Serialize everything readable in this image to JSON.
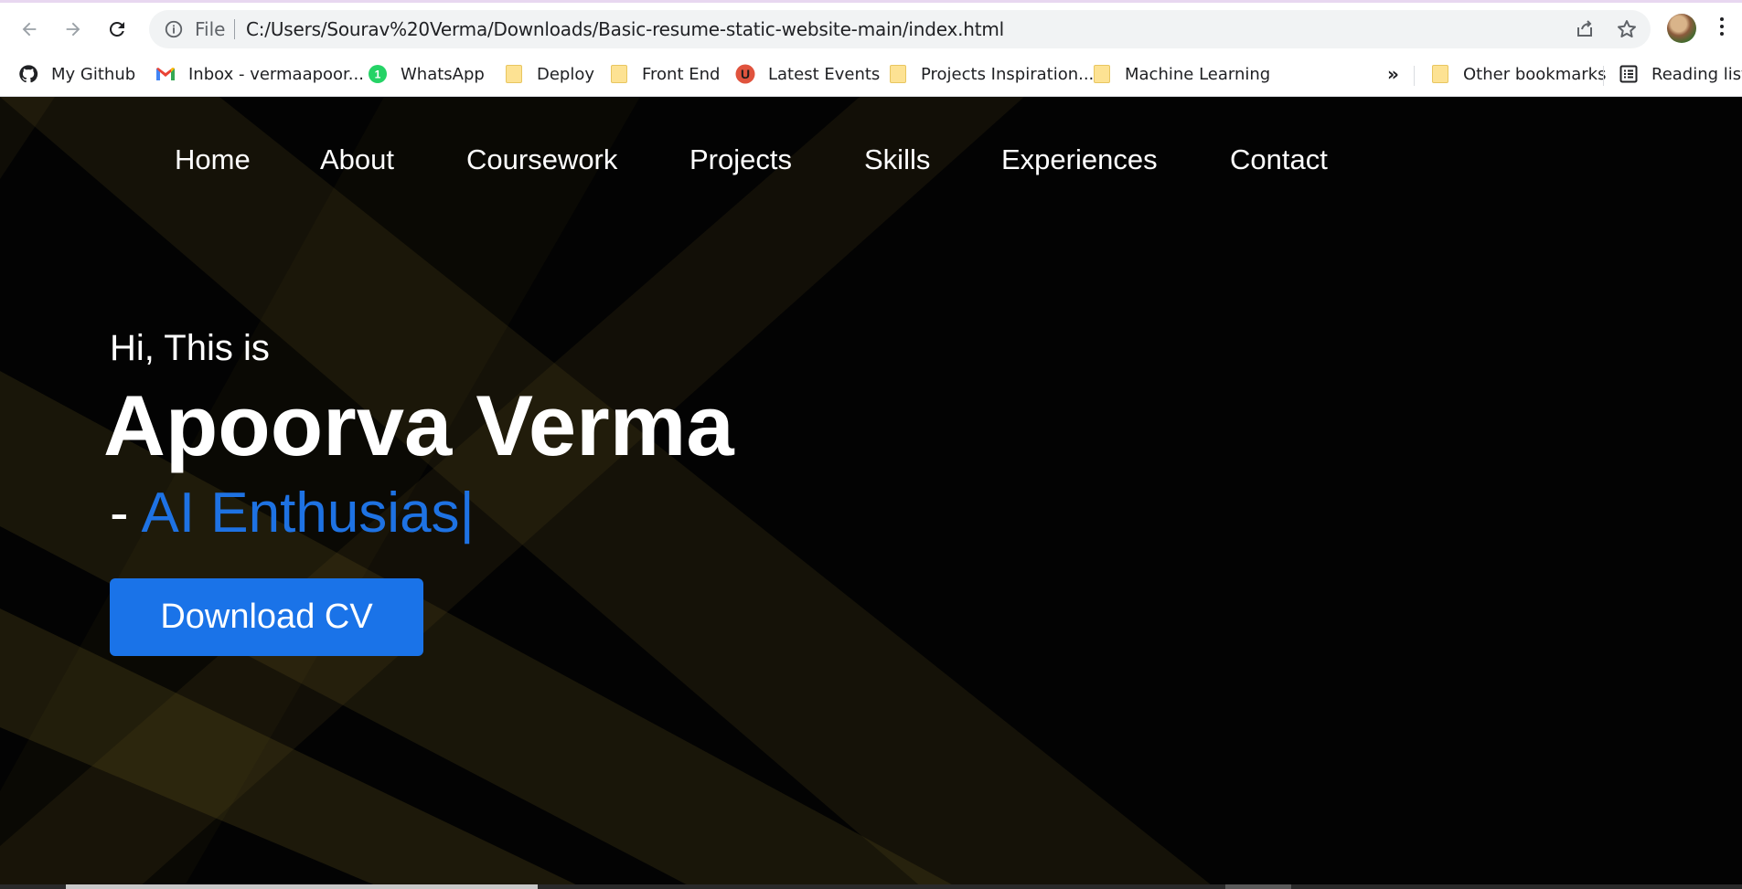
{
  "browser": {
    "address_scheme": "File",
    "url": "C:/Users/Sourav%20Verma/Downloads/Basic-resume-static-website-main/index.html",
    "bookmarks": [
      {
        "label": "My Github",
        "icon": "github-icon"
      },
      {
        "label": "Inbox - vermaapoor...",
        "icon": "gmail-icon"
      },
      {
        "label": "WhatsApp",
        "icon": "whatsapp-icon",
        "badge": "1"
      },
      {
        "label": "Deploy",
        "icon": "folder-icon"
      },
      {
        "label": "Front End",
        "icon": "folder-icon"
      },
      {
        "label": "Latest Events",
        "icon": "unstop-icon",
        "badge": "U"
      },
      {
        "label": "Projects Inspiration...",
        "icon": "folder-icon"
      },
      {
        "label": "Machine Learning",
        "icon": "folder-icon"
      }
    ],
    "overflow_label": "»",
    "other_bookmarks": "Other bookmarks",
    "reading_list": "Reading list"
  },
  "nav": {
    "items": [
      "Home",
      "About",
      "Coursework",
      "Projects",
      "Skills",
      "Experiences",
      "Contact"
    ]
  },
  "hero": {
    "greeting": "Hi, This is",
    "name": "Apoorva Verma",
    "dash": "-",
    "role_typed": "AI Enthusias",
    "cursor": "|",
    "cv_button": "Download CV"
  },
  "colors": {
    "accent": "#1a73e8",
    "role_text": "#1e72e3",
    "background": "#030303",
    "ray_color": "#6b5a1f"
  }
}
